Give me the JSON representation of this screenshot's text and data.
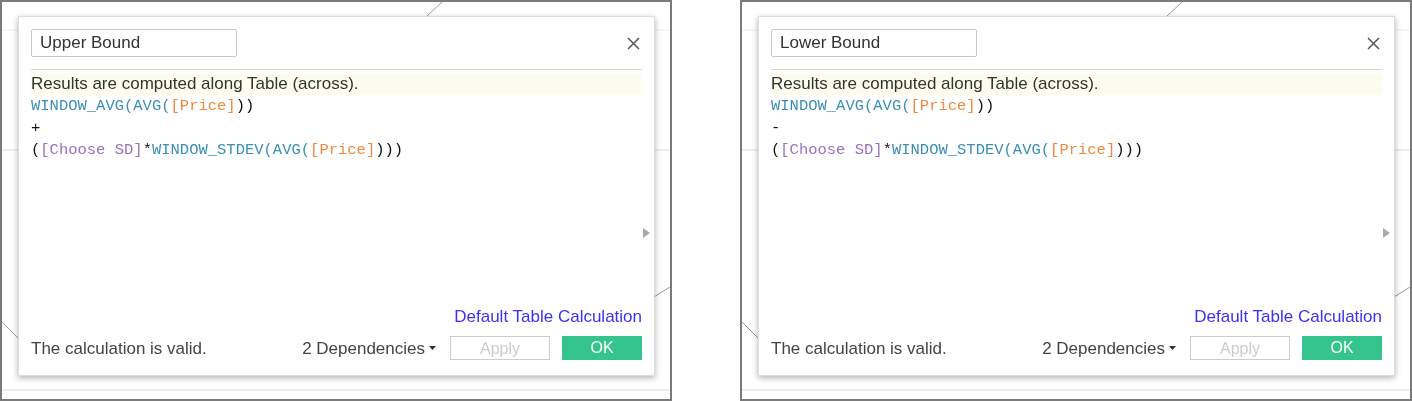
{
  "dialogs": [
    {
      "name": "Upper Bound",
      "info": "Results are computed along Table (across).",
      "code_lines": [
        [
          {
            "kind": "function",
            "text": "WINDOW_AVG(AVG("
          },
          {
            "kind": "field",
            "text": "[Price]"
          },
          {
            "kind": "plain",
            "text": "))"
          }
        ],
        [
          {
            "kind": "plain",
            "text": "+"
          }
        ],
        [
          {
            "kind": "plain",
            "text": "("
          },
          {
            "kind": "parameter",
            "text": "[Choose SD]"
          },
          {
            "kind": "plain",
            "text": "*"
          },
          {
            "kind": "function",
            "text": "WINDOW_STDEV(AVG("
          },
          {
            "kind": "field",
            "text": "[Price]"
          },
          {
            "kind": "plain",
            "text": ")))"
          }
        ]
      ],
      "link": "Default Table Calculation",
      "status": "The calculation is valid.",
      "dependencies": "2 Dependencies",
      "apply": {
        "label": "Apply",
        "disabled": true
      },
      "ok": "OK"
    },
    {
      "name": "Lower Bound",
      "info": "Results are computed along Table (across).",
      "code_lines": [
        [
          {
            "kind": "function",
            "text": "WINDOW_AVG(AVG("
          },
          {
            "kind": "field",
            "text": "[Price]"
          },
          {
            "kind": "plain",
            "text": "))"
          }
        ],
        [
          {
            "kind": "plain",
            "text": "-"
          }
        ],
        [
          {
            "kind": "plain",
            "text": "("
          },
          {
            "kind": "parameter",
            "text": "[Choose SD]"
          },
          {
            "kind": "plain",
            "text": "*"
          },
          {
            "kind": "function",
            "text": "WINDOW_STDEV(AVG("
          },
          {
            "kind": "field",
            "text": "[Price]"
          },
          {
            "kind": "plain",
            "text": ")))"
          }
        ]
      ],
      "link": "Default Table Calculation",
      "status": "The calculation is valid.",
      "dependencies": "2 Dependencies",
      "apply": {
        "label": "Apply",
        "disabled": true
      },
      "ok": "OK"
    }
  ]
}
